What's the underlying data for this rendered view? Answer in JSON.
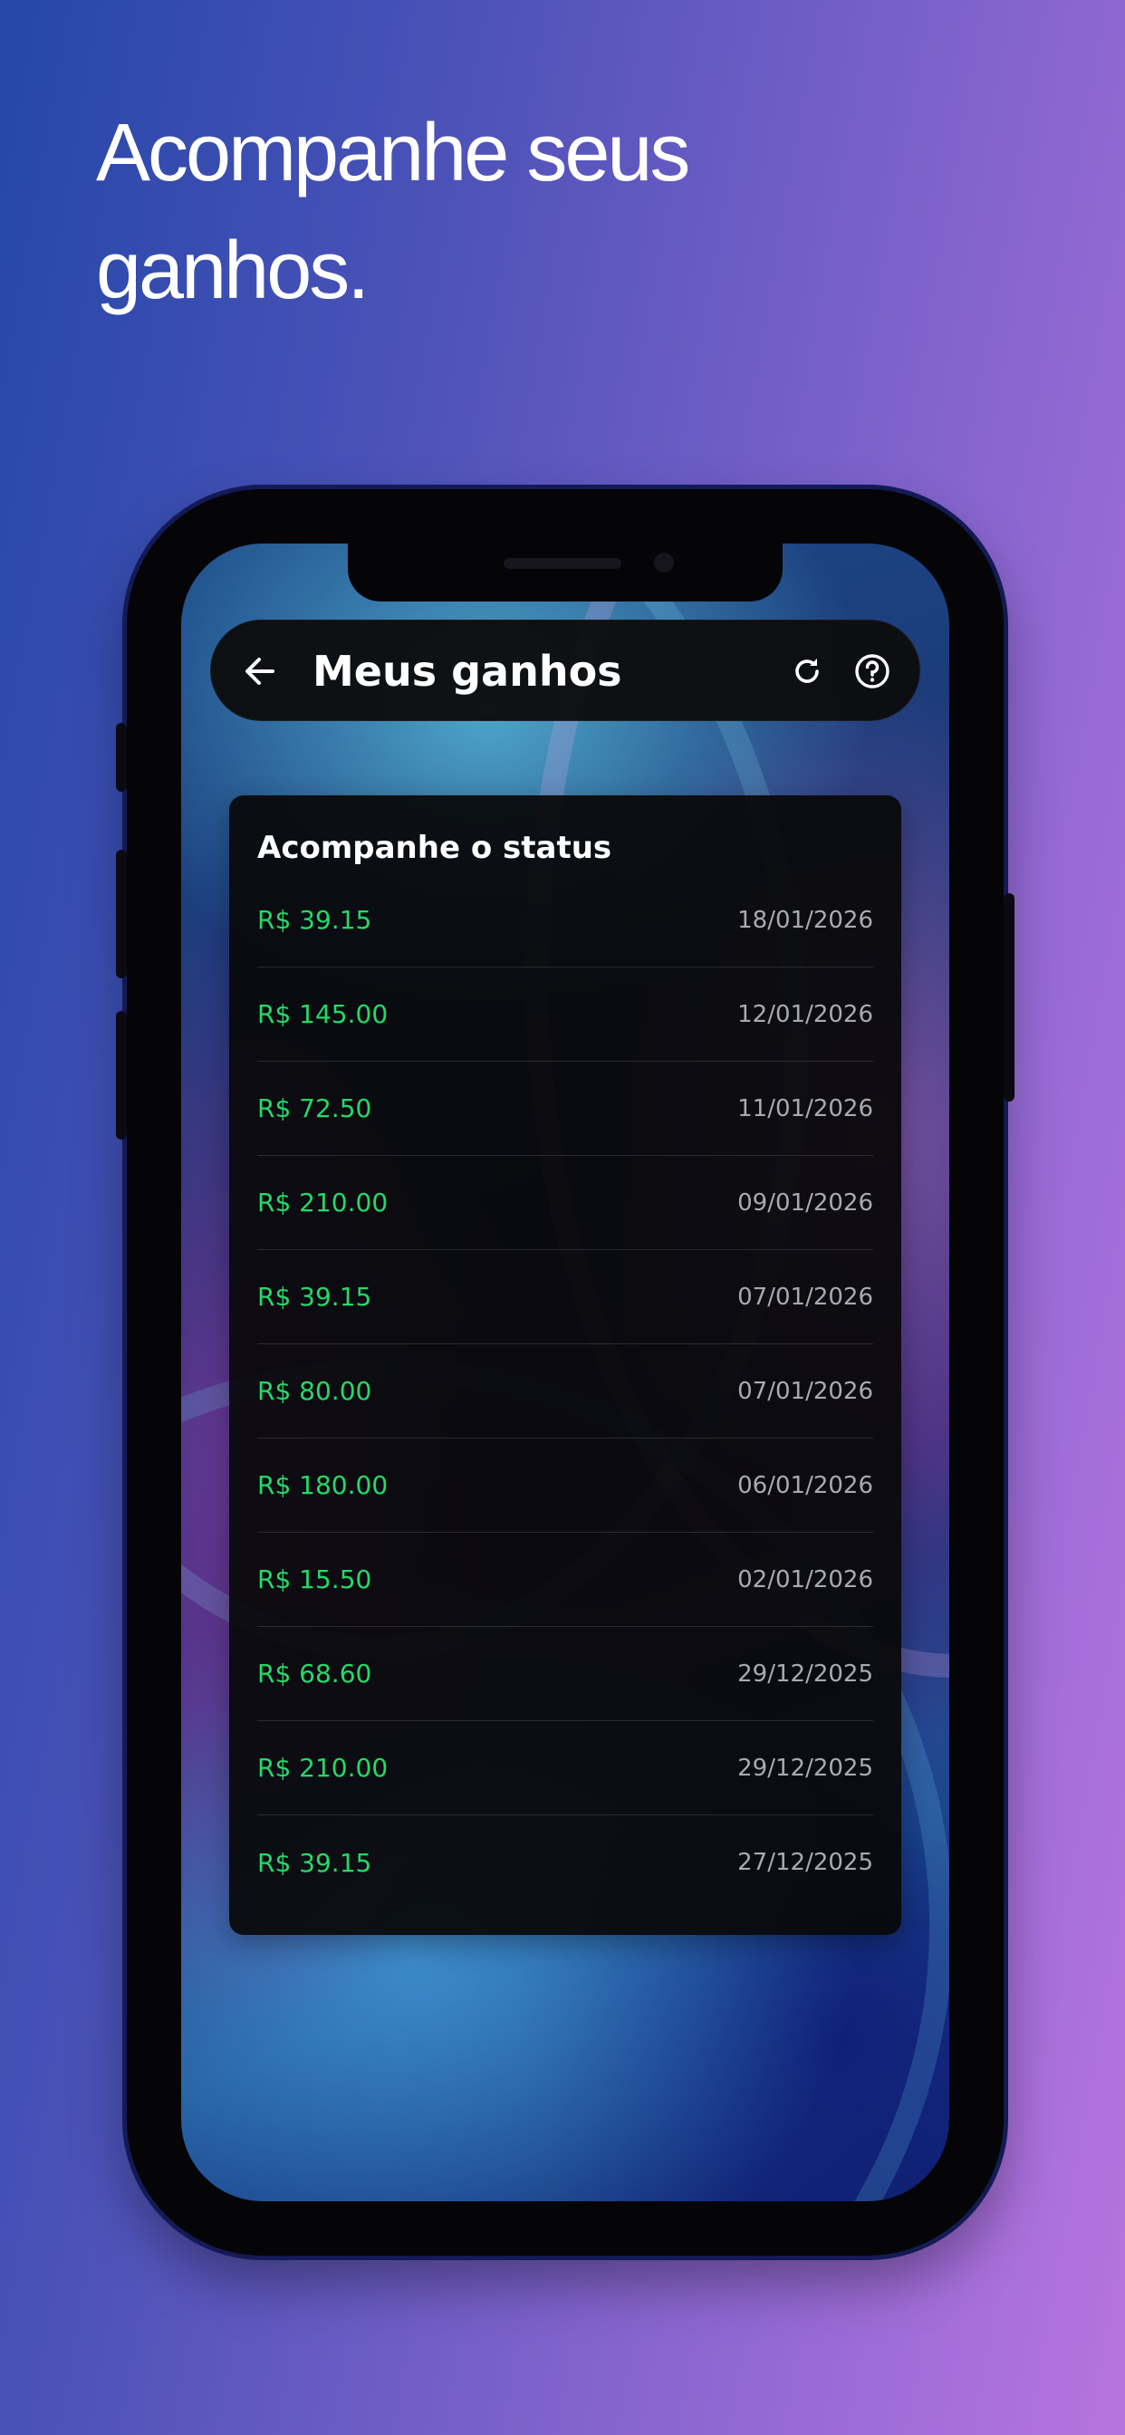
{
  "headline": "Acompanhe seus ganhos.",
  "app": {
    "title": "Meus ganhos",
    "back_icon": "arrow-left-icon",
    "refresh_icon": "refresh-icon",
    "help_icon": "help-circle-icon"
  },
  "card": {
    "title": "Acompanhe o status",
    "entries": [
      {
        "amount": "R$ 39.15",
        "date": "18/01/2026"
      },
      {
        "amount": "R$ 145.00",
        "date": "12/01/2026"
      },
      {
        "amount": "R$ 72.50",
        "date": "11/01/2026"
      },
      {
        "amount": "R$ 210.00",
        "date": "09/01/2026"
      },
      {
        "amount": "R$ 39.15",
        "date": "07/01/2026"
      },
      {
        "amount": "R$ 80.00",
        "date": "07/01/2026"
      },
      {
        "amount": "R$ 180.00",
        "date": "06/01/2026"
      },
      {
        "amount": "R$ 15.50",
        "date": "02/01/2026"
      },
      {
        "amount": "R$ 68.60",
        "date": "29/12/2025"
      },
      {
        "amount": "R$ 210.00",
        "date": "29/12/2025"
      },
      {
        "amount": "R$ 39.15",
        "date": "27/12/2025"
      }
    ]
  },
  "colors": {
    "amount": "#24d968",
    "date": "#a9a9b0",
    "background_start": "#2447a8",
    "background_end": "#b774e0"
  }
}
